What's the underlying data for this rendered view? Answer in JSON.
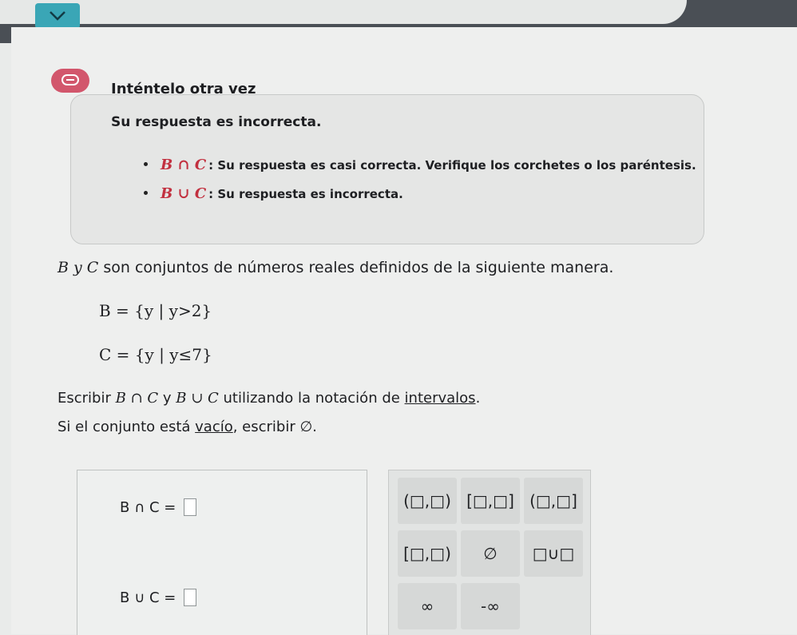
{
  "feedback": {
    "title": "Inténtelo otra vez",
    "lead": "Su respuesta es incorrecta.",
    "items": [
      {
        "math": "B ∩ C",
        "text": ": Su respuesta es casi correcta. Verifique los corchetes o los paréntesis."
      },
      {
        "math": "B ∪ C",
        "text": ": Su respuesta es incorrecta."
      }
    ]
  },
  "problem": {
    "intro_sets": "B y C",
    "intro_rest": " son conjuntos de números reales definidos de la siguiente manera.",
    "def_b": "B = {y | y>2}",
    "def_c": "C = {y | y≤7}",
    "instr_pre": "Escribir ",
    "instr_b_int_c": "B ∩ C",
    "instr_y": " y ",
    "instr_b_uni_c": "B ∪ C",
    "instr_mid": " utilizando la notación de ",
    "instr_link": "intervalos",
    "instr_end": ".",
    "empty_pre": "Si el conjunto está ",
    "empty_link": "vacío",
    "empty_end": ", escribir ∅."
  },
  "answers": {
    "intersection_label": "B ∩ C =",
    "union_label": "B ∪ C ="
  },
  "keypad": {
    "row1": [
      "(□,□)",
      "[□,□]",
      "(□,□]"
    ],
    "row2": [
      "[□,□)",
      "∅",
      "□∪□"
    ],
    "row3": [
      "∞",
      "-∞",
      ""
    ]
  },
  "colors": {
    "accent": "#3aa6b6",
    "error": "#d2566c",
    "math_error": "#c2303f"
  }
}
